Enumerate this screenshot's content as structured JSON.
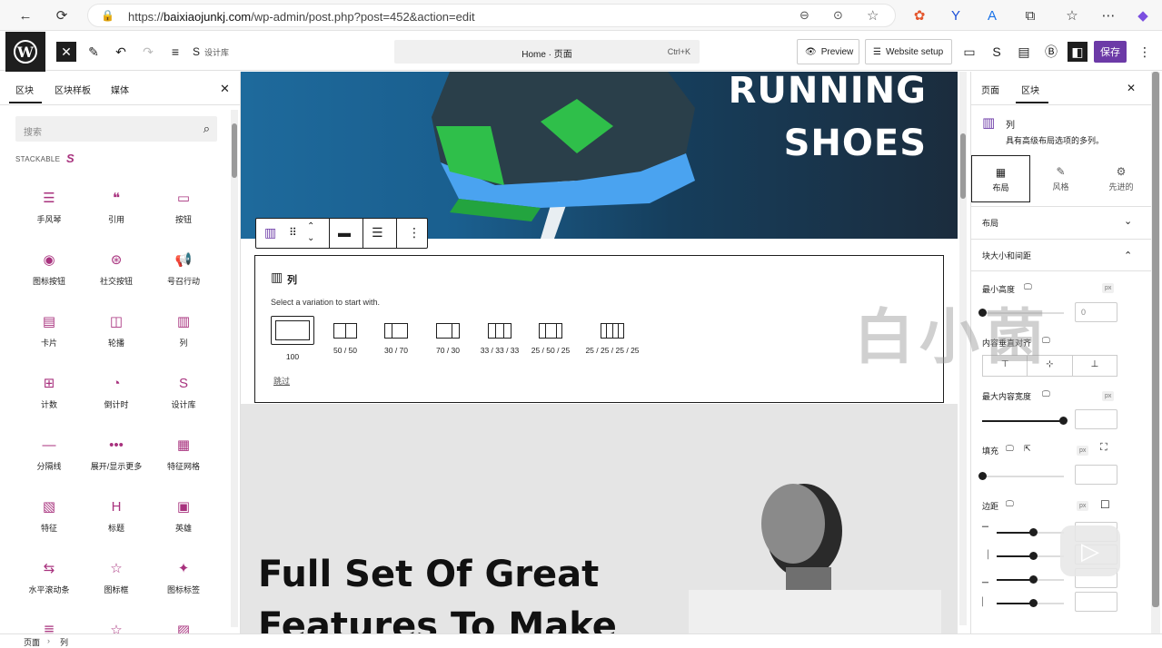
{
  "browser": {
    "url_prefix": "https://",
    "url_host": "baixiaojunkj.com",
    "url_path": "/wp-admin/post.php?post=452&action=edit"
  },
  "toolbar": {
    "document_title": "Home · 页面",
    "shortcut": "Ctrl+K",
    "preview_label": "Preview",
    "website_setup_label": "Website setup",
    "save_label": "保存"
  },
  "inserter": {
    "tabs": [
      "区块",
      "区块样板",
      "媒体"
    ],
    "search_placeholder": "搜索",
    "category": "STACKABLE",
    "blocks": [
      {
        "label": "手风琴",
        "icon": "accordion-icon",
        "glyph": "☰"
      },
      {
        "label": "引用",
        "icon": "quote-icon",
        "glyph": "❝"
      },
      {
        "label": "按钮",
        "icon": "button-icon",
        "glyph": "▭"
      },
      {
        "label": "图标按钮",
        "icon": "icon-button-icon",
        "glyph": "◉"
      },
      {
        "label": "社交按钮",
        "icon": "social-buttons-icon",
        "glyph": "⊛"
      },
      {
        "label": "号召行动",
        "icon": "call-to-action-icon",
        "glyph": "📢"
      },
      {
        "label": "卡片",
        "icon": "card-icon",
        "glyph": "▤"
      },
      {
        "label": "轮播",
        "icon": "carousel-icon",
        "glyph": "◫"
      },
      {
        "label": "列",
        "icon": "columns-icon",
        "glyph": "▥"
      },
      {
        "label": "计数",
        "icon": "count-up-icon",
        "glyph": "⊞"
      },
      {
        "label": "倒计时",
        "icon": "countdown-icon",
        "glyph": "◔"
      },
      {
        "label": "设计库",
        "icon": "design-library-icon",
        "glyph": "S"
      },
      {
        "label": "分隔线",
        "icon": "divider-icon",
        "glyph": "—"
      },
      {
        "label": "展开/显示更多",
        "icon": "expand-icon",
        "glyph": "•••"
      },
      {
        "label": "特征网格",
        "icon": "feature-grid-icon",
        "glyph": "▦"
      },
      {
        "label": "特征",
        "icon": "feature-icon",
        "glyph": "▧"
      },
      {
        "label": "标题",
        "icon": "heading-icon",
        "glyph": "H"
      },
      {
        "label": "英雄",
        "icon": "hero-icon",
        "glyph": "▣"
      },
      {
        "label": "水平滚动条",
        "icon": "horizontal-scroller-icon",
        "glyph": "⇆"
      },
      {
        "label": "图标框",
        "icon": "icon-box-icon",
        "glyph": "☆"
      },
      {
        "label": "图标标签",
        "icon": "icon-label-icon",
        "glyph": "✦"
      },
      {
        "label": "",
        "icon": "icon-list-icon",
        "glyph": "≣"
      },
      {
        "label": "",
        "icon": "star-icon",
        "glyph": "☆"
      },
      {
        "label": "",
        "icon": "image-icon",
        "glyph": "▨"
      }
    ]
  },
  "canvas": {
    "hero_line1": "RUNNING",
    "hero_line2": "SHOES",
    "columns_block": {
      "title": "列",
      "instruction": "Select a variation to start with.",
      "variations": [
        "100",
        "50 / 50",
        "30 / 70",
        "70 / 30",
        "33 / 33 / 33",
        "25 / 50 / 25",
        "25 / 25 / 25 / 25"
      ],
      "skip_label": "跳过"
    },
    "headline_line1": "Full Set Of Great",
    "headline_line2": "Features To Make"
  },
  "settings": {
    "tabs": [
      "页面",
      "区块"
    ],
    "block_name": "列",
    "block_description": "具有高级布局选项的多列。",
    "subtabs": [
      "布局",
      "风格",
      "先进的"
    ],
    "section_layout": "布局",
    "section_size": "块大小和间距",
    "min_height_label": "最小高度",
    "min_height_value": "0",
    "content_vertical_align_label": "内容垂直对齐",
    "max_content_width_label": "最大内容宽度",
    "padding_label": "填充",
    "margin_label": "边距",
    "unit_px": "px"
  },
  "breadcrumb": [
    "页面",
    "列"
  ],
  "watermark": "白小菌",
  "colors": {
    "accent": "#6c3aa7",
    "stackable": "#a8327e",
    "dark": "#1e1e1e"
  }
}
